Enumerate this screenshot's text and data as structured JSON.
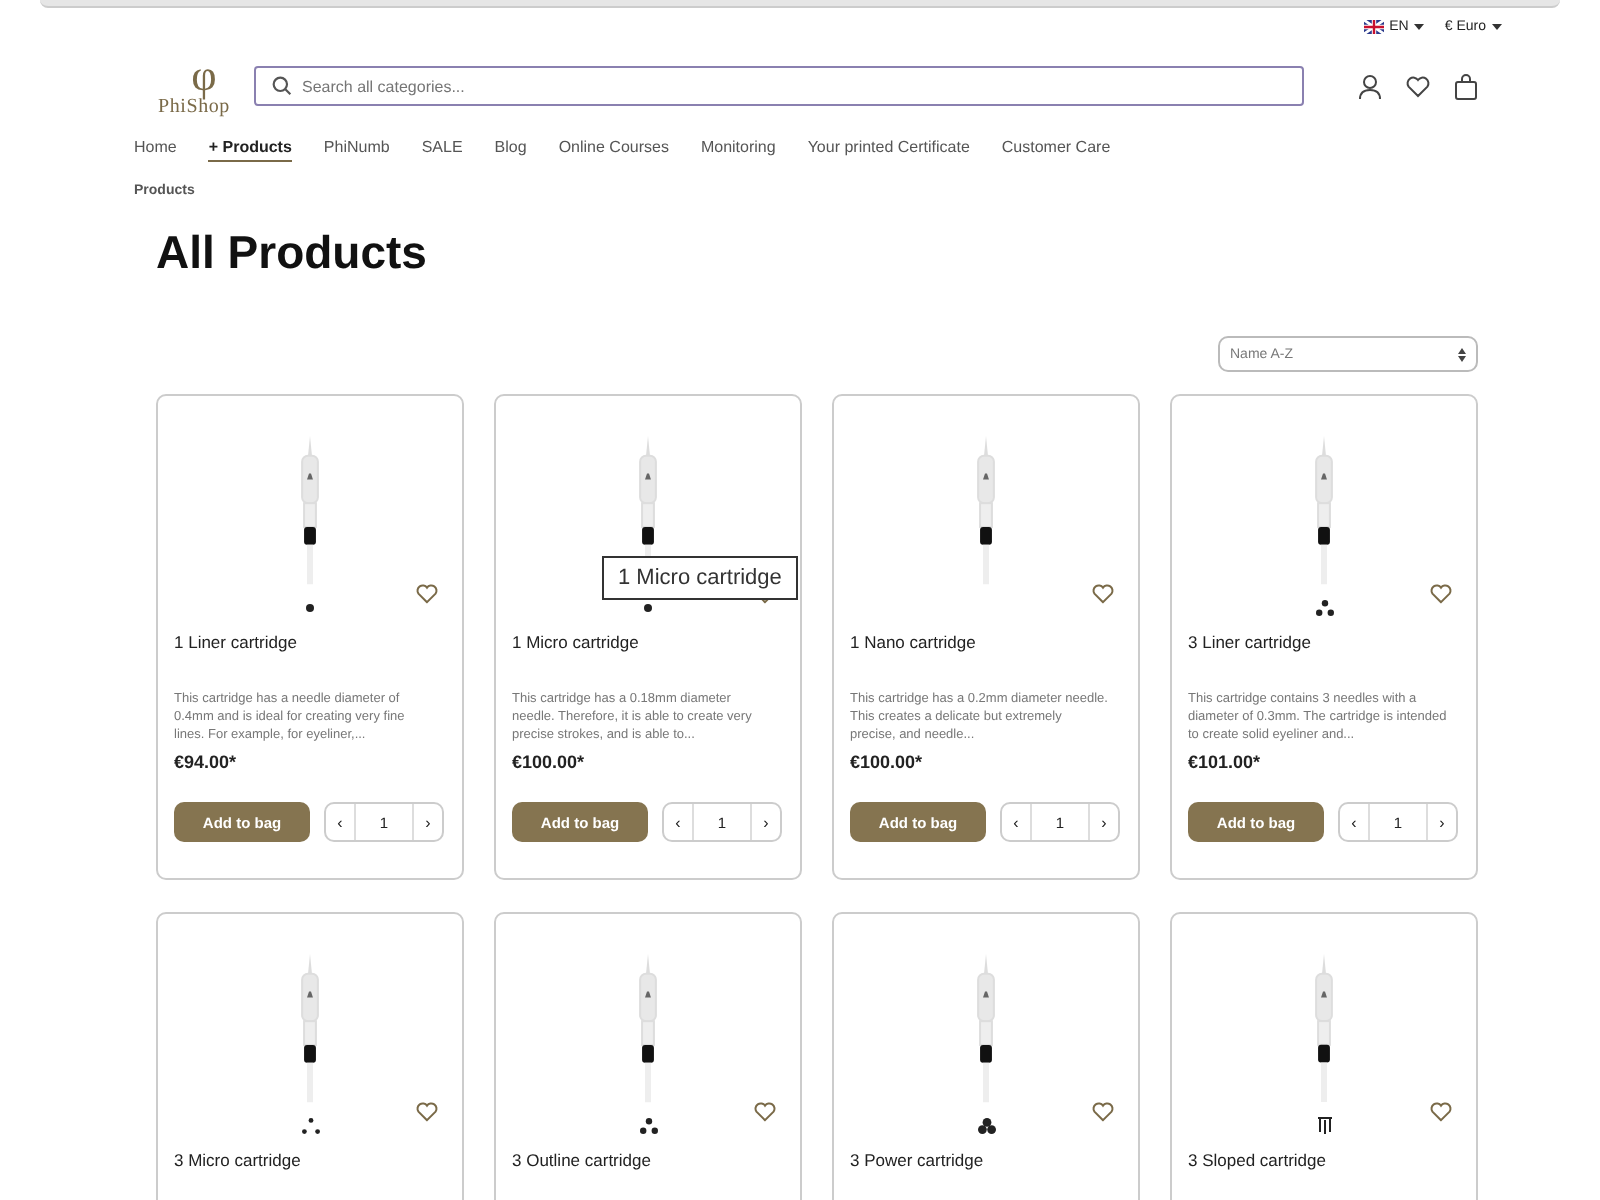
{
  "topbar": {
    "language": "EN",
    "currency": "€ Euro"
  },
  "header": {
    "logo_mark": "φ",
    "logo_text": "PhiShop",
    "search": {
      "placeholder": "Search all categories..."
    }
  },
  "nav": [
    {
      "label": "Home",
      "selected": false
    },
    {
      "label": "+ Products",
      "selected": true
    },
    {
      "label": "PhiNumb",
      "selected": false
    },
    {
      "label": "SALE",
      "selected": false
    },
    {
      "label": "Blog",
      "selected": false
    },
    {
      "label": "Online Courses",
      "selected": false
    },
    {
      "label": "Monitoring",
      "selected": false
    },
    {
      "label": "Your printed Certificate",
      "selected": false
    },
    {
      "label": "Customer Care",
      "selected": false
    }
  ],
  "breadcrumb": "Products",
  "title": "All Products",
  "sort": {
    "value": "Name A-Z"
  },
  "tooltip": "1 Micro cartridge",
  "products": [
    {
      "name": "1 Liner cartridge",
      "kind": "single",
      "description": "This cartridge has a needle diameter of 0.4mm and is ideal for creating very fine lines. For example, for eyeliner,...",
      "price": "€94.00*",
      "button": "Add to bag",
      "qty": "1",
      "dec": "‹",
      "inc": "›"
    },
    {
      "name": "1 Micro cartridge",
      "kind": "single",
      "description": "This cartridge has a 0.18mm diameter needle. Therefore, it is able to create very precise strokes, and is able to...",
      "price": "€100.00*",
      "button": "Add to bag",
      "qty": "1",
      "dec": "‹",
      "inc": "›"
    },
    {
      "name": "1 Nano cartridge",
      "kind": "none",
      "description": "This cartridge has a 0.2mm diameter needle. This creates a delicate but extremely precise, and needle...",
      "price": "€100.00*",
      "button": "Add to bag",
      "qty": "1",
      "dec": "‹",
      "inc": "›"
    },
    {
      "name": "3 Liner cartridge",
      "kind": "triple",
      "description": "This cartridge contains 3 needles with a diameter of 0.3mm. The cartridge is intended to create solid eyeliner and...",
      "price": "€101.00*",
      "button": "Add to bag",
      "qty": "1",
      "dec": "‹",
      "inc": "›"
    },
    {
      "name": "3 Micro cartridge",
      "kind": "triple-small"
    },
    {
      "name": "3 Outline cartridge",
      "kind": "triple"
    },
    {
      "name": "3 Power cartridge",
      "kind": "triple-bold"
    },
    {
      "name": "3 Sloped cartridge",
      "kind": "sloped"
    }
  ]
}
